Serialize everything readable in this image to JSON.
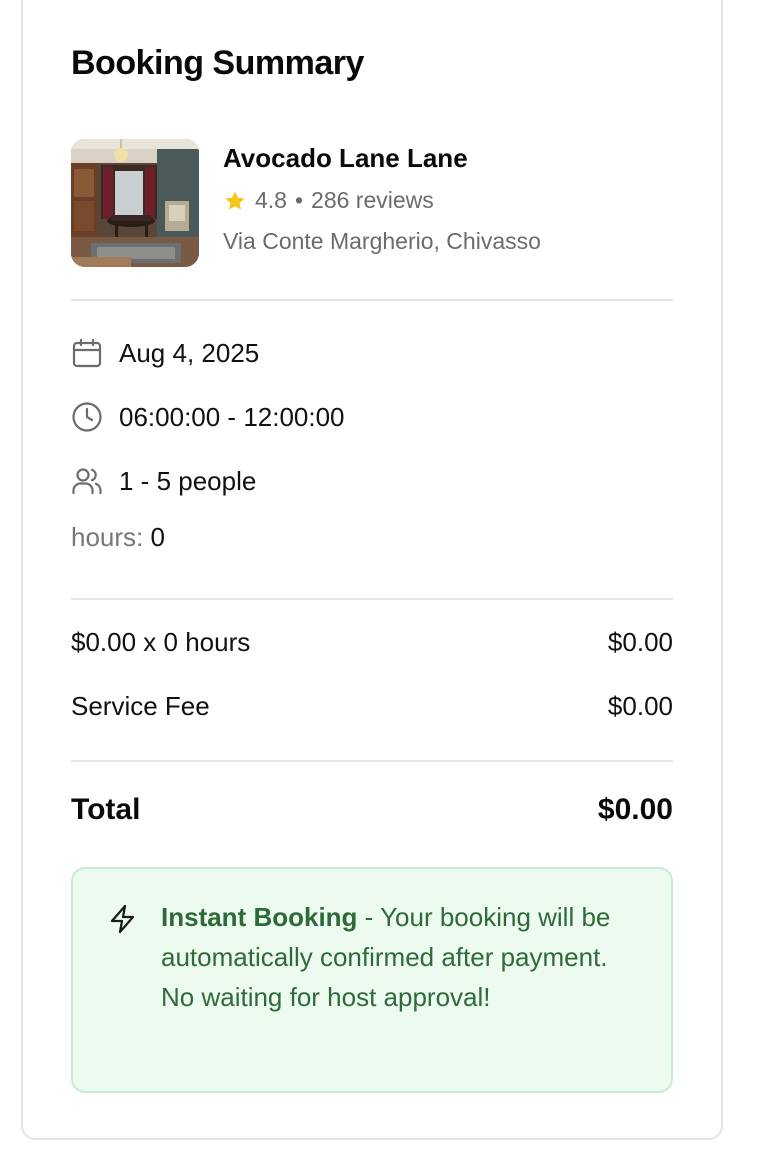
{
  "summary": {
    "title": "Booking Summary"
  },
  "listing": {
    "name": "Avocado Lane Lane",
    "rating": "4.8",
    "separator": "•",
    "reviews": "286 reviews",
    "address": "Via Conte Margherio, Chivasso",
    "image_icon": "room-photo"
  },
  "details": {
    "date": "Aug 4, 2025",
    "date_icon": "calendar-icon",
    "time": "06:00:00 - 12:00:00",
    "time_icon": "clock-icon",
    "people": "1 - 5 people",
    "people_icon": "users-icon",
    "hours_label": "hours:",
    "hours_value": "0"
  },
  "pricing": {
    "rate_label": "$0.00 x 0 hours",
    "rate_value": "$0.00",
    "fee_label": "Service Fee",
    "fee_value": "$0.00",
    "total_label": "Total",
    "total_value": "$0.00"
  },
  "notice": {
    "icon": "lightning-icon",
    "strong": "Instant Booking",
    "text": " - Your booking will be automatically confirmed after payment. No waiting for host approval!"
  },
  "colors": {
    "star": "#F5C518",
    "notice_bg": "#ECFAEF",
    "notice_border": "#C5ECCE",
    "notice_text": "#2F6A3A"
  }
}
